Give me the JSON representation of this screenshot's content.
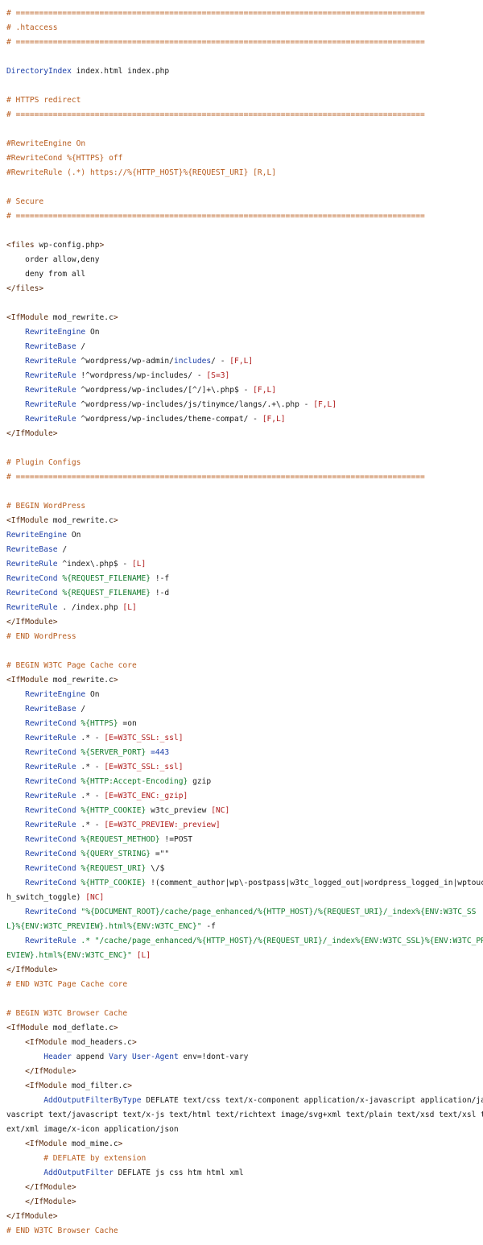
{
  "colors": {
    "comment": "#b85c1e",
    "directive": "#1c3fa8",
    "tag": "#5a2a0c",
    "string": "#127a2c",
    "flag": "#b01b1b",
    "text": "#1a1a1a",
    "background": "#ffffff"
  },
  "lines": [
    [
      {
        "t": "# ========================================================================================",
        "c": "cmt"
      }
    ],
    [
      {
        "t": "# .htaccess",
        "c": "cmt"
      }
    ],
    [
      {
        "t": "# ========================================================================================",
        "c": "cmt"
      }
    ],
    [],
    [
      {
        "t": "DirectoryIndex",
        "c": "dir"
      },
      {
        "t": " index.html index.php"
      }
    ],
    [],
    [
      {
        "t": "# HTTPS redirect",
        "c": "cmt"
      }
    ],
    [
      {
        "t": "# ========================================================================================",
        "c": "cmt"
      }
    ],
    [],
    [
      {
        "t": "#RewriteEngine On",
        "c": "cmt"
      }
    ],
    [
      {
        "t": "#RewriteCond %{HTTPS} off",
        "c": "cmt"
      }
    ],
    [
      {
        "t": "#RewriteRule (.*) https://%{HTTP_HOST}%{REQUEST_URI} [R,L]",
        "c": "cmt"
      }
    ],
    [],
    [
      {
        "t": "# Secure",
        "c": "cmt"
      }
    ],
    [
      {
        "t": "# ========================================================================================",
        "c": "cmt"
      }
    ],
    [],
    [
      {
        "t": "<files",
        "c": "tag"
      },
      {
        "t": " wp-config.php"
      },
      {
        "t": ">",
        "c": "tag"
      }
    ],
    [
      {
        "t": "    order allow,deny"
      }
    ],
    [
      {
        "t": "    deny from all"
      }
    ],
    [
      {
        "t": "</files>",
        "c": "tag"
      }
    ],
    [],
    [
      {
        "t": "<IfModule",
        "c": "tag"
      },
      {
        "t": " mod_rewrite.c"
      },
      {
        "t": ">",
        "c": "tag"
      }
    ],
    [
      {
        "t": "    "
      },
      {
        "t": "RewriteEngine",
        "c": "dir"
      },
      {
        "t": " On"
      }
    ],
    [
      {
        "t": "    "
      },
      {
        "t": "RewriteBase",
        "c": "dir"
      },
      {
        "t": " /"
      }
    ],
    [
      {
        "t": "    "
      },
      {
        "t": "RewriteRule",
        "c": "dir"
      },
      {
        "t": " ^wordpress/wp-admin/"
      },
      {
        "t": "includes",
        "c": "dir"
      },
      {
        "t": "/ - "
      },
      {
        "t": "[F,L]",
        "c": "red"
      }
    ],
    [
      {
        "t": "    "
      },
      {
        "t": "RewriteRule",
        "c": "dir"
      },
      {
        "t": " !^wordpress/wp-includes/ - "
      },
      {
        "t": "[S=3]",
        "c": "red"
      }
    ],
    [
      {
        "t": "    "
      },
      {
        "t": "RewriteRule",
        "c": "dir"
      },
      {
        "t": " ^wordpress/wp-includes/[^/]+\\.php$ - "
      },
      {
        "t": "[F,L]",
        "c": "red"
      }
    ],
    [
      {
        "t": "    "
      },
      {
        "t": "RewriteRule",
        "c": "dir"
      },
      {
        "t": " ^wordpress/wp-includes/js/tinymce/langs/.+\\.php - "
      },
      {
        "t": "[F,L]",
        "c": "red"
      }
    ],
    [
      {
        "t": "    "
      },
      {
        "t": "RewriteRule",
        "c": "dir"
      },
      {
        "t": " ^wordpress/wp-includes/theme-compat/ - "
      },
      {
        "t": "[F,L]",
        "c": "red"
      }
    ],
    [
      {
        "t": "</IfModule>",
        "c": "tag"
      }
    ],
    [],
    [
      {
        "t": "# Plugin Configs",
        "c": "cmt"
      }
    ],
    [
      {
        "t": "# ========================================================================================",
        "c": "cmt"
      }
    ],
    [],
    [
      {
        "t": "# BEGIN WordPress",
        "c": "cmt"
      }
    ],
    [
      {
        "t": "<IfModule",
        "c": "tag"
      },
      {
        "t": " mod_rewrite.c"
      },
      {
        "t": ">",
        "c": "tag"
      }
    ],
    [
      {
        "t": "RewriteEngine",
        "c": "dir"
      },
      {
        "t": " On"
      }
    ],
    [
      {
        "t": "RewriteBase",
        "c": "dir"
      },
      {
        "t": " /"
      }
    ],
    [
      {
        "t": "RewriteRule",
        "c": "dir"
      },
      {
        "t": " ^index\\.php$ - "
      },
      {
        "t": "[L]",
        "c": "red"
      }
    ],
    [
      {
        "t": "RewriteCond",
        "c": "dir"
      },
      {
        "t": " "
      },
      {
        "t": "%{REQUEST_FILENAME}",
        "c": "grn"
      },
      {
        "t": " !-f"
      }
    ],
    [
      {
        "t": "RewriteCond",
        "c": "dir"
      },
      {
        "t": " "
      },
      {
        "t": "%{REQUEST_FILENAME}",
        "c": "grn"
      },
      {
        "t": " !-d"
      }
    ],
    [
      {
        "t": "RewriteRule",
        "c": "dir"
      },
      {
        "t": " . /index.php "
      },
      {
        "t": "[L]",
        "c": "red"
      }
    ],
    [
      {
        "t": "</IfModule>",
        "c": "tag"
      }
    ],
    [
      {
        "t": "# END WordPress",
        "c": "cmt"
      }
    ],
    [],
    [
      {
        "t": "# BEGIN W3TC Page Cache core",
        "c": "cmt"
      }
    ],
    [
      {
        "t": "<IfModule",
        "c": "tag"
      },
      {
        "t": " mod_rewrite.c"
      },
      {
        "t": ">",
        "c": "tag"
      }
    ],
    [
      {
        "t": "    "
      },
      {
        "t": "RewriteEngine",
        "c": "dir"
      },
      {
        "t": " On"
      }
    ],
    [
      {
        "t": "    "
      },
      {
        "t": "RewriteBase",
        "c": "dir"
      },
      {
        "t": " /"
      }
    ],
    [
      {
        "t": "    "
      },
      {
        "t": "RewriteCond",
        "c": "dir"
      },
      {
        "t": " "
      },
      {
        "t": "%{HTTPS}",
        "c": "grn"
      },
      {
        "t": " =on"
      }
    ],
    [
      {
        "t": "    "
      },
      {
        "t": "RewriteRule",
        "c": "dir"
      },
      {
        "t": " .* - "
      },
      {
        "t": "[E=W3TC_SSL:_ssl]",
        "c": "red"
      }
    ],
    [
      {
        "t": "    "
      },
      {
        "t": "RewriteCond",
        "c": "dir"
      },
      {
        "t": " "
      },
      {
        "t": "%{SERVER_PORT}",
        "c": "grn"
      },
      {
        "t": " =443",
        "c": "dir"
      }
    ],
    [
      {
        "t": "    "
      },
      {
        "t": "RewriteRule",
        "c": "dir"
      },
      {
        "t": " .* - "
      },
      {
        "t": "[E=W3TC_SSL:_ssl]",
        "c": "red"
      }
    ],
    [
      {
        "t": "    "
      },
      {
        "t": "RewriteCond",
        "c": "dir"
      },
      {
        "t": " "
      },
      {
        "t": "%{HTTP:Accept-Encoding}",
        "c": "grn"
      },
      {
        "t": " gzip"
      }
    ],
    [
      {
        "t": "    "
      },
      {
        "t": "RewriteRule",
        "c": "dir"
      },
      {
        "t": " .* - "
      },
      {
        "t": "[E=W3TC_ENC:_gzip]",
        "c": "red"
      }
    ],
    [
      {
        "t": "    "
      },
      {
        "t": "RewriteCond",
        "c": "dir"
      },
      {
        "t": " "
      },
      {
        "t": "%{HTTP_COOKIE}",
        "c": "grn"
      },
      {
        "t": " w3tc_preview "
      },
      {
        "t": "[NC]",
        "c": "red"
      }
    ],
    [
      {
        "t": "    "
      },
      {
        "t": "RewriteRule",
        "c": "dir"
      },
      {
        "t": " .* - "
      },
      {
        "t": "[E=W3TC_PREVIEW:_preview]",
        "c": "red"
      }
    ],
    [
      {
        "t": "    "
      },
      {
        "t": "RewriteCond",
        "c": "dir"
      },
      {
        "t": " "
      },
      {
        "t": "%{REQUEST_METHOD}",
        "c": "grn"
      },
      {
        "t": " !=POST"
      }
    ],
    [
      {
        "t": "    "
      },
      {
        "t": "RewriteCond",
        "c": "dir"
      },
      {
        "t": " "
      },
      {
        "t": "%{QUERY_STRING}",
        "c": "grn"
      },
      {
        "t": " =\"\""
      }
    ],
    [
      {
        "t": "    "
      },
      {
        "t": "RewriteCond",
        "c": "dir"
      },
      {
        "t": " "
      },
      {
        "t": "%{REQUEST_URI}",
        "c": "grn"
      },
      {
        "t": " \\/$"
      }
    ],
    [
      {
        "t": "    "
      },
      {
        "t": "RewriteCond",
        "c": "dir"
      },
      {
        "t": " "
      },
      {
        "t": "%{HTTP_COOKIE}",
        "c": "grn"
      },
      {
        "t": " !(comment_author|wp\\-postpass|w3tc_logged_out|wordpress_logged_in|wptouch_switch_toggle) "
      },
      {
        "t": "[NC]",
        "c": "red"
      }
    ],
    [
      {
        "t": "    "
      },
      {
        "t": "RewriteCond",
        "c": "dir"
      },
      {
        "t": " \"%{DOCUMENT_ROOT}/cache/page_enhanced/%{HTTP_HOST}/%{REQUEST_URI}/_index%{ENV:W3TC_SSL}%{ENV:W3TC_PREVIEW}.html%{ENV:W3TC_ENC}\"",
        "c": "grn"
      },
      {
        "t": " -f"
      }
    ],
    [
      {
        "t": "    "
      },
      {
        "t": "RewriteRule",
        "c": "dir"
      },
      {
        "t": " .* \"/cache/page_enhanced/%{HTTP_HOST}/%{REQUEST_URI}/_index%{ENV:W3TC_SSL}%{ENV:W3TC_PREVIEW}.html%{ENV:W3TC_ENC}\"",
        "c": "grn"
      },
      {
        "t": " "
      },
      {
        "t": "[L]",
        "c": "red"
      }
    ],
    [
      {
        "t": "</IfModule>",
        "c": "tag"
      }
    ],
    [
      {
        "t": "# END W3TC Page Cache core",
        "c": "cmt"
      }
    ],
    [],
    [
      {
        "t": "# BEGIN W3TC Browser Cache",
        "c": "cmt"
      }
    ],
    [
      {
        "t": "<IfModule",
        "c": "tag"
      },
      {
        "t": " mod_deflate.c"
      },
      {
        "t": ">",
        "c": "tag"
      }
    ],
    [
      {
        "t": "    "
      },
      {
        "t": "<IfModule",
        "c": "tag"
      },
      {
        "t": " mod_headers.c"
      },
      {
        "t": ">",
        "c": "tag"
      }
    ],
    [
      {
        "t": "        "
      },
      {
        "t": "Header",
        "c": "dir"
      },
      {
        "t": " append "
      },
      {
        "t": "Vary",
        "c": "dir"
      },
      {
        "t": " "
      },
      {
        "t": "User-Agent",
        "c": "dir"
      },
      {
        "t": " env=!dont-vary"
      }
    ],
    [
      {
        "t": "    "
      },
      {
        "t": "</IfModule>",
        "c": "tag"
      }
    ],
    [
      {
        "t": "    "
      },
      {
        "t": "<IfModule",
        "c": "tag"
      },
      {
        "t": " mod_filter.c"
      },
      {
        "t": ">",
        "c": "tag"
      }
    ],
    [
      {
        "t": "        "
      },
      {
        "t": "AddOutputFilterByType",
        "c": "dir"
      },
      {
        "t": " DEFLATE text/css text/x-component application/x-javascript application/javascript text/javascript text/x-js text/html text/richtext image/svg+xml text/plain text/xsd text/xsl text/xml image/x-icon application/json"
      }
    ],
    [
      {
        "t": "    "
      },
      {
        "t": "<IfModule",
        "c": "tag"
      },
      {
        "t": " mod_mime.c"
      },
      {
        "t": ">",
        "c": "tag"
      }
    ],
    [
      {
        "t": "        "
      },
      {
        "t": "# DEFLATE by extension",
        "c": "cmt"
      }
    ],
    [
      {
        "t": "        "
      },
      {
        "t": "AddOutputFilter",
        "c": "dir"
      },
      {
        "t": " DEFLATE js css htm html xml"
      }
    ],
    [
      {
        "t": "    "
      },
      {
        "t": "</IfModule>",
        "c": "tag"
      }
    ],
    [
      {
        "t": "    "
      },
      {
        "t": "</IfModule>",
        "c": "tag"
      }
    ],
    [
      {
        "t": "</IfModule>",
        "c": "tag"
      }
    ],
    [
      {
        "t": "# END W3TC Browser Cache",
        "c": "cmt"
      }
    ]
  ]
}
